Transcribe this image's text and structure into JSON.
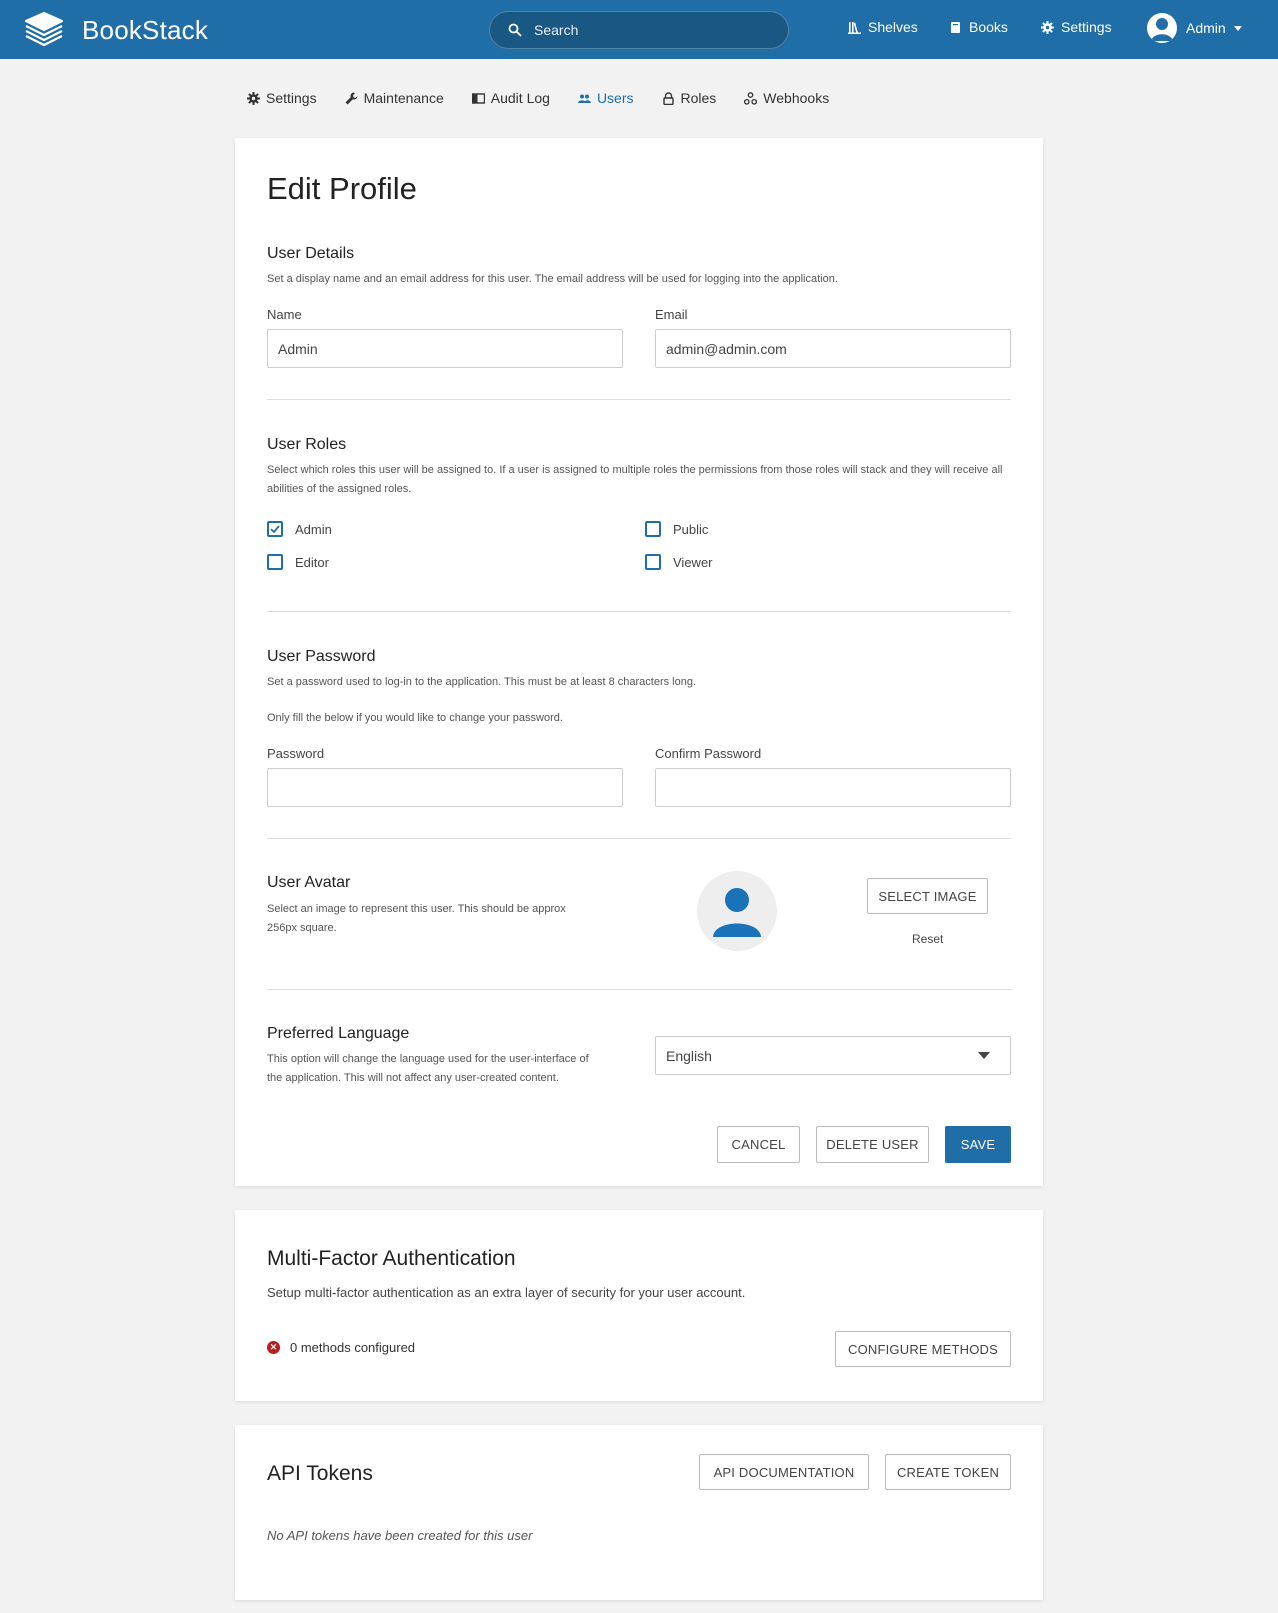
{
  "header": {
    "app_name": "BookStack",
    "search_placeholder": "Search",
    "nav": {
      "shelves": "Shelves",
      "books": "Books",
      "settings": "Settings"
    },
    "user_name": "Admin",
    "accent_color": "#206ea7"
  },
  "tabs": [
    {
      "label": "Settings",
      "icon": "gear-icon"
    },
    {
      "label": "Maintenance",
      "icon": "wrench-icon"
    },
    {
      "label": "Audit Log",
      "icon": "book-open-icon"
    },
    {
      "label": "Users",
      "icon": "users-icon",
      "active": true
    },
    {
      "label": "Roles",
      "icon": "lock-icon"
    },
    {
      "label": "Webhooks",
      "icon": "webhook-icon"
    }
  ],
  "edit_profile": {
    "title": "Edit Profile",
    "user_details": {
      "title": "User Details",
      "description": "Set a display name and an email address for this user. The email address will be used for logging into the application.",
      "name_label": "Name",
      "name_value": "Admin",
      "email_label": "Email",
      "email_value": "admin@admin.com"
    },
    "user_roles": {
      "title": "User Roles",
      "description": "Select which roles this user will be assigned to. If a user is assigned to multiple roles the permissions from those roles will stack and they will receive all abilities of the assigned roles.",
      "roles": [
        {
          "label": "Admin",
          "checked": true
        },
        {
          "label": "Public",
          "checked": false
        },
        {
          "label": "Editor",
          "checked": false
        },
        {
          "label": "Viewer",
          "checked": false
        }
      ]
    },
    "user_password": {
      "title": "User Password",
      "description": "Set a password used to log-in to the application. This must be at least 8 characters long.",
      "note": "Only fill the below if you would like to change your password.",
      "password_label": "Password",
      "confirm_label": "Confirm Password"
    },
    "user_avatar": {
      "title": "User Avatar",
      "description_line1": "Select an image to represent this user. This should be approx",
      "description_line2": "256px square.",
      "select_button": "Select Image",
      "reset_link": "Reset"
    },
    "preferred_language": {
      "title": "Preferred Language",
      "description_line1": "This option will change the language used for the user-interface of",
      "description_line2": "the application. This will not affect any user-created content.",
      "selected": "English"
    },
    "buttons": {
      "cancel": "Cancel",
      "delete": "Delete User",
      "save": "Save"
    }
  },
  "mfa": {
    "title": "Multi-Factor Authentication",
    "description": "Setup multi-factor authentication as an extra layer of security for your user account.",
    "status": "0 methods configured",
    "configure_button": "Configure Methods"
  },
  "api_tokens": {
    "title": "API Tokens",
    "docs_button": "API Documentation",
    "create_button": "Create Token",
    "empty_message": "No API tokens have been created for this user"
  }
}
